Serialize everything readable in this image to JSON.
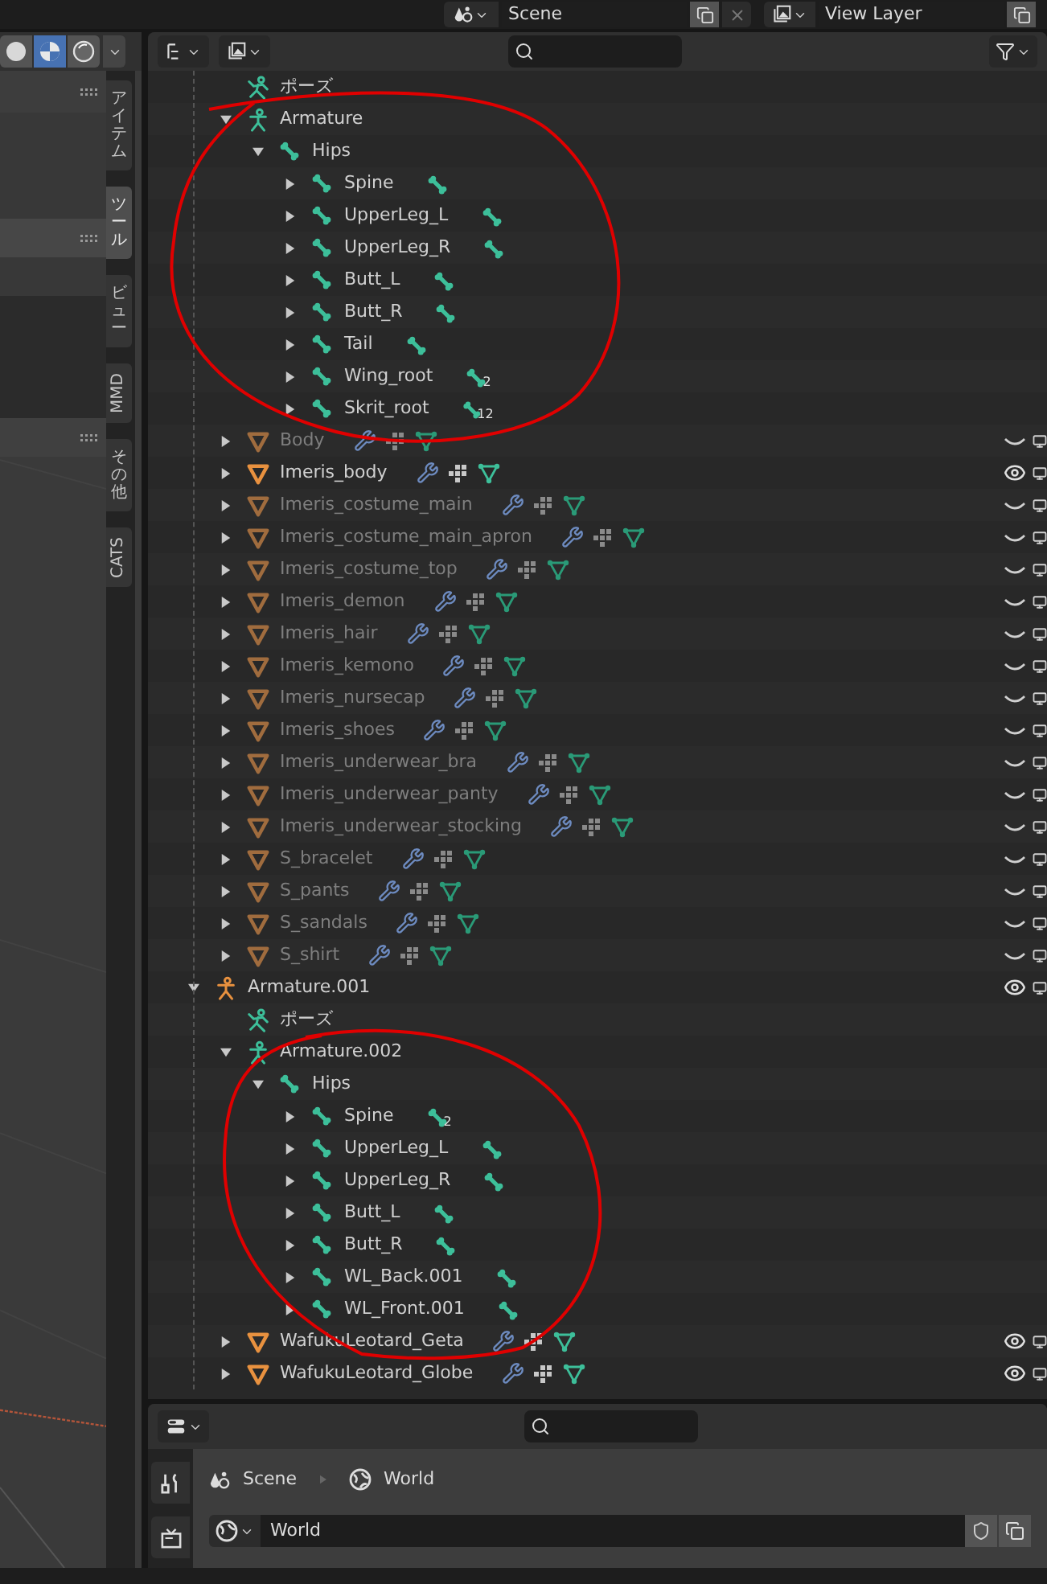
{
  "top_bar": {
    "scene": "Scene",
    "view_layer": "View Layer"
  },
  "viewport": {
    "shading": [
      {
        "kind": "solid",
        "selected": false
      },
      {
        "kind": "material",
        "selected": true
      },
      {
        "kind": "rendered",
        "selected": false
      }
    ],
    "sidebar_tabs": [
      {
        "label": "アイテム",
        "kind": "stacked",
        "selected": false
      },
      {
        "label": "ツール",
        "kind": "stacked",
        "selected": true
      },
      {
        "label": "ビュー",
        "kind": "stacked",
        "selected": false
      },
      {
        "label": "MMD",
        "kind": "rotated",
        "selected": false
      },
      {
        "label": "その他",
        "kind": "stacked",
        "selected": false
      },
      {
        "label": "CATS",
        "kind": "rotated",
        "selected": false
      }
    ]
  },
  "outliner": {
    "continued": [
      {
        "name": "ポーズ",
        "kind": "pose"
      },
      {
        "name": "Armature",
        "kind": "armature",
        "expanded": true,
        "children": [
          {
            "name": "Hips",
            "kind": "bone",
            "expanded": true,
            "children": [
              {
                "name": "Spine",
                "kind": "bone",
                "expanded": false
              },
              {
                "name": "UpperLeg_L",
                "kind": "bone",
                "expanded": false
              },
              {
                "name": "UpperLeg_R",
                "kind": "bone",
                "expanded": false
              },
              {
                "name": "Butt_L",
                "kind": "bone",
                "expanded": false
              },
              {
                "name": "Butt_R",
                "kind": "bone",
                "expanded": false
              },
              {
                "name": "Tail",
                "kind": "bone",
                "expanded": false
              },
              {
                "name": "Wing_root",
                "kind": "bone",
                "expanded": false,
                "badge": "2"
              },
              {
                "name": "Skrit_root",
                "kind": "bone",
                "expanded": false,
                "badge": "12"
              }
            ]
          }
        ]
      },
      {
        "name": "Body",
        "kind": "mesh",
        "expanded": false,
        "visible": false
      },
      {
        "name": "Imeris_body",
        "kind": "mesh",
        "expanded": false,
        "visible": true
      },
      {
        "name": "Imeris_costume_main",
        "kind": "mesh",
        "expanded": false,
        "visible": false
      },
      {
        "name": "Imeris_costume_main_apron",
        "kind": "mesh",
        "expanded": false,
        "visible": false
      },
      {
        "name": "Imeris_costume_top",
        "kind": "mesh",
        "expanded": false,
        "visible": false
      },
      {
        "name": "Imeris_demon",
        "kind": "mesh",
        "expanded": false,
        "visible": false
      },
      {
        "name": "Imeris_hair",
        "kind": "mesh",
        "expanded": false,
        "visible": false
      },
      {
        "name": "Imeris_kemono",
        "kind": "mesh",
        "expanded": false,
        "visible": false
      },
      {
        "name": "Imeris_nursecap",
        "kind": "mesh",
        "expanded": false,
        "visible": false
      },
      {
        "name": "Imeris_shoes",
        "kind": "mesh",
        "expanded": false,
        "visible": false
      },
      {
        "name": "Imeris_underwear_bra",
        "kind": "mesh",
        "expanded": false,
        "visible": false
      },
      {
        "name": "Imeris_underwear_panty",
        "kind": "mesh",
        "expanded": false,
        "visible": false
      },
      {
        "name": "Imeris_underwear_stocking",
        "kind": "mesh",
        "expanded": false,
        "visible": false
      },
      {
        "name": "S_bracelet",
        "kind": "mesh",
        "expanded": false,
        "visible": false
      },
      {
        "name": "S_pants",
        "kind": "mesh",
        "expanded": false,
        "visible": false
      },
      {
        "name": "S_sandals",
        "kind": "mesh",
        "expanded": false,
        "visible": false
      },
      {
        "name": "S_shirt",
        "kind": "mesh",
        "expanded": false,
        "visible": false
      }
    ],
    "items": [
      {
        "name": "Armature.001",
        "kind": "armature_object",
        "expanded": true,
        "visible": true,
        "children": [
          {
            "name": "ポーズ",
            "kind": "pose"
          },
          {
            "name": "Armature.002",
            "kind": "armature",
            "expanded": true,
            "children": [
              {
                "name": "Hips",
                "kind": "bone",
                "expanded": true,
                "children": [
                  {
                    "name": "Spine",
                    "kind": "bone",
                    "expanded": false,
                    "badge": "2"
                  },
                  {
                    "name": "UpperLeg_L",
                    "kind": "bone",
                    "expanded": false
                  },
                  {
                    "name": "UpperLeg_R",
                    "kind": "bone",
                    "expanded": false
                  },
                  {
                    "name": "Butt_L",
                    "kind": "bone",
                    "expanded": false
                  },
                  {
                    "name": "Butt_R",
                    "kind": "bone",
                    "expanded": false
                  },
                  {
                    "name": "WL_Back.001",
                    "kind": "bone",
                    "expanded": false
                  },
                  {
                    "name": "WL_Front.001",
                    "kind": "bone",
                    "expanded": false
                  }
                ]
              }
            ]
          },
          {
            "name": "WafukuLeotard_Geta",
            "kind": "mesh",
            "expanded": false,
            "visible": true
          },
          {
            "name": "WafukuLeotard_Globe",
            "kind": "mesh",
            "expanded": false,
            "visible": true
          }
        ]
      }
    ]
  },
  "properties": {
    "breadcrumb": [
      "Scene",
      "World"
    ],
    "world_field": "World"
  }
}
